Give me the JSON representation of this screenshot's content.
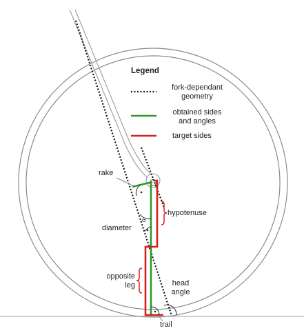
{
  "legend": {
    "title": "Legend",
    "items": [
      {
        "label": "fork-dependant geometry",
        "line1": "fork-dependant",
        "line2": "geometry",
        "style": "dotted",
        "color": "#111111"
      },
      {
        "label": "obtained sides and angles",
        "line1": "obtained sides",
        "line2": "and angles",
        "style": "solid",
        "color": "#2a9a2a"
      },
      {
        "label": "target sides",
        "line1": "target sides",
        "line2": "",
        "style": "solid",
        "color": "#d62020"
      }
    ]
  },
  "labels": {
    "rake": "rake",
    "hypotenuse": "hypotenuse",
    "diameter": "diameter",
    "opposite_leg_line1": "opposite",
    "opposite_leg_line2": "leg",
    "head_angle_line1": "head",
    "head_angle_line2": "angle",
    "trail": "trail",
    "alpha_symbol": "α"
  },
  "colors": {
    "wheel": "#8a8a8a",
    "fork": "#9a9a9a",
    "ground": "#b0b0b0",
    "green": "#2a9a2a",
    "red": "#d62020",
    "dotted": "#111111",
    "arc": "#222222"
  }
}
